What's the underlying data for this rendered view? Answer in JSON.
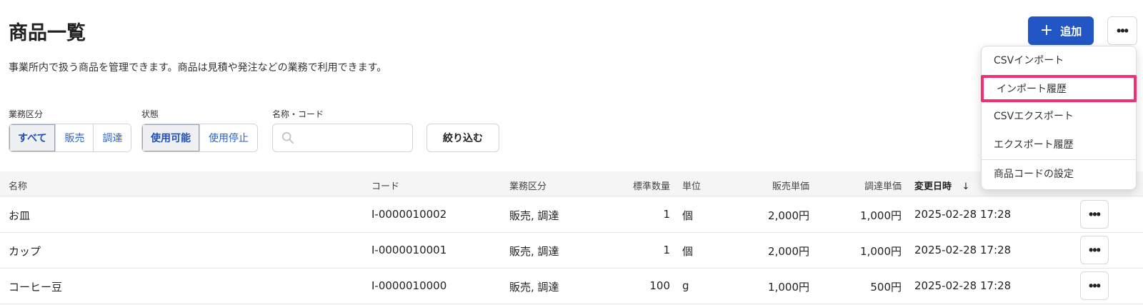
{
  "page": {
    "title": "商品一覧",
    "description": "事業所内で扱う商品を管理できます。商品は見積や発注などの業務で利用できます。"
  },
  "header": {
    "add_label": "追加",
    "add_icon": "plus-icon",
    "more_icon": "ellipsis-icon"
  },
  "filters": {
    "business_label": "業務区分",
    "business_options": [
      "すべて",
      "販売",
      "調達"
    ],
    "status_label": "状態",
    "status_options": [
      "使用可能",
      "使用停止"
    ],
    "search_label": "名称・コード",
    "search_placeholder": "",
    "filter_button": "絞り込む"
  },
  "table": {
    "columns": [
      "名称",
      "コード",
      "業務区分",
      "標準数量",
      "単位",
      "販売単価",
      "調達単価",
      "変更日時"
    ],
    "sort_indicator": "↓",
    "rows": [
      {
        "name": "お皿",
        "code": "I-0000010002",
        "business": "販売, 調達",
        "qty": "1",
        "unit": "個",
        "sale": "2,000円",
        "purchase": "1,000円",
        "updated": "2025-02-28 17:28"
      },
      {
        "name": "カップ",
        "code": "I-0000010001",
        "business": "販売, 調達",
        "qty": "1",
        "unit": "個",
        "sale": "2,000円",
        "purchase": "1,000円",
        "updated": "2025-02-28 17:28"
      },
      {
        "name": "コーヒー豆",
        "code": "I-0000010000",
        "business": "販売, 調達",
        "qty": "100",
        "unit": "g",
        "sale": "1,000円",
        "purchase": "500円",
        "updated": "2025-02-28 17:28"
      }
    ]
  },
  "dropdown": {
    "items": [
      "CSVインポート",
      "インポート履歴",
      "CSVエクスポート",
      "エクスポート履歴",
      "商品コードの設定"
    ],
    "highlighted": "インポート履歴"
  },
  "colors": {
    "primary": "#2256c4",
    "highlight": "#f2306f"
  }
}
